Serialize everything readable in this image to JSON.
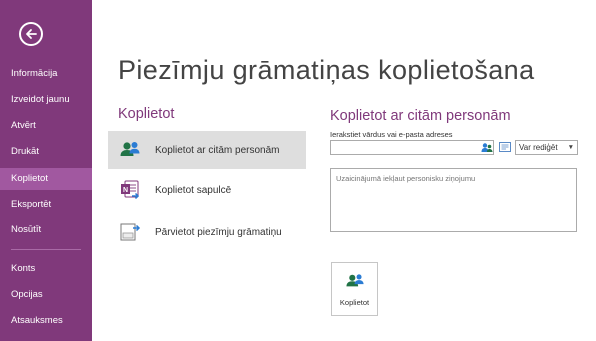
{
  "sidebar": {
    "back_icon": "back-arrow-icon",
    "items": [
      {
        "label": "Informācija",
        "active": false
      },
      {
        "label": "Izveidot jaunu",
        "active": false
      },
      {
        "label": "Atvērt",
        "active": false
      },
      {
        "label": "Drukāt",
        "active": false
      },
      {
        "label": "Koplietot",
        "active": true
      },
      {
        "label": "Eksportēt",
        "active": false
      },
      {
        "label": "Nosūtīt",
        "active": false
      }
    ],
    "bottom_items": [
      {
        "label": "Konts"
      },
      {
        "label": "Opcijas"
      },
      {
        "label": "Atsauksmes"
      }
    ],
    "colors": {
      "background": "#80397b",
      "active": "#a158a0"
    }
  },
  "main": {
    "title": "Piezīmju grāmatiņas koplietošana",
    "share_section": {
      "title": "Koplietot",
      "options": [
        {
          "label": "Koplietot ar citām personām",
          "icon": "share-people-icon",
          "selected": true
        },
        {
          "label": "Koplietot sapulcē",
          "icon": "onenote-meeting-icon",
          "selected": false
        },
        {
          "label": "Pārvietot piezīmju grāmatiņu",
          "icon": "move-notebook-icon",
          "selected": false
        }
      ]
    },
    "people_section": {
      "title": "Koplietot ar citām personām",
      "hint": "Ierakstiet vārdus vai e-pasta adreses",
      "email_value": "",
      "permission": "Var rediģēt",
      "message_placeholder": "Uzaicinājumā iekļaut personisku ziņojumu",
      "button_label": "Koplietot",
      "button_icon": "share-people-icon"
    },
    "colors": {
      "accent": "#80397b",
      "selected_bg": "#dedede"
    }
  }
}
